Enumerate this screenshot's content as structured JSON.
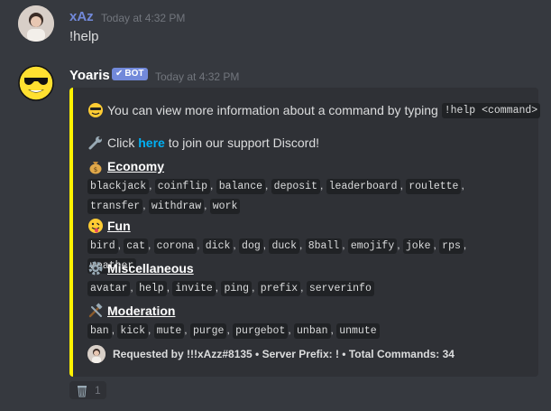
{
  "message1": {
    "username": "xAz",
    "username_color": "#7289da",
    "timestamp": "Today at 4:32 PM",
    "text": "!help",
    "avatar_icon": "user-photo-icon"
  },
  "message2": {
    "username": "Yoaris",
    "bot_tag": "BOT",
    "timestamp": "Today at 4:32 PM",
    "avatar_icon": "sunglasses-face-icon"
  },
  "embed": {
    "accent_color": "#fff200",
    "intro_pre": "You can view more information about a command by typing",
    "intro_code": "!help <command>",
    "support_pre": "Click",
    "support_link": "here",
    "support_post": "to join our support Discord!",
    "fields": [
      {
        "icon": "money-bag-icon",
        "title": "Economy",
        "commands": [
          "blackjack",
          "coinflip",
          "balance",
          "deposit",
          "leaderboard",
          "roulette",
          "transfer",
          "withdraw",
          "work"
        ]
      },
      {
        "icon": "tongue-face-icon",
        "title": "Fun",
        "commands": [
          "bird",
          "cat",
          "corona",
          "dick",
          "dog",
          "duck",
          "8ball",
          "emojify",
          "joke",
          "rps",
          "weather"
        ]
      },
      {
        "icon": "gear-icon",
        "title": "Miscellaneous",
        "commands": [
          "avatar",
          "help",
          "invite",
          "ping",
          "prefix",
          "serverinfo"
        ]
      },
      {
        "icon": "hammer-wrench-icon",
        "title": "Moderation",
        "commands": [
          "ban",
          "kick",
          "mute",
          "purge",
          "purgebot",
          "unban",
          "unmute"
        ]
      }
    ],
    "footer": "Requested by !!!xAzz#8135 • Server Prefix: ! • Total Commands: 34"
  },
  "reaction": {
    "icon": "wastebasket-icon",
    "count": "1"
  }
}
